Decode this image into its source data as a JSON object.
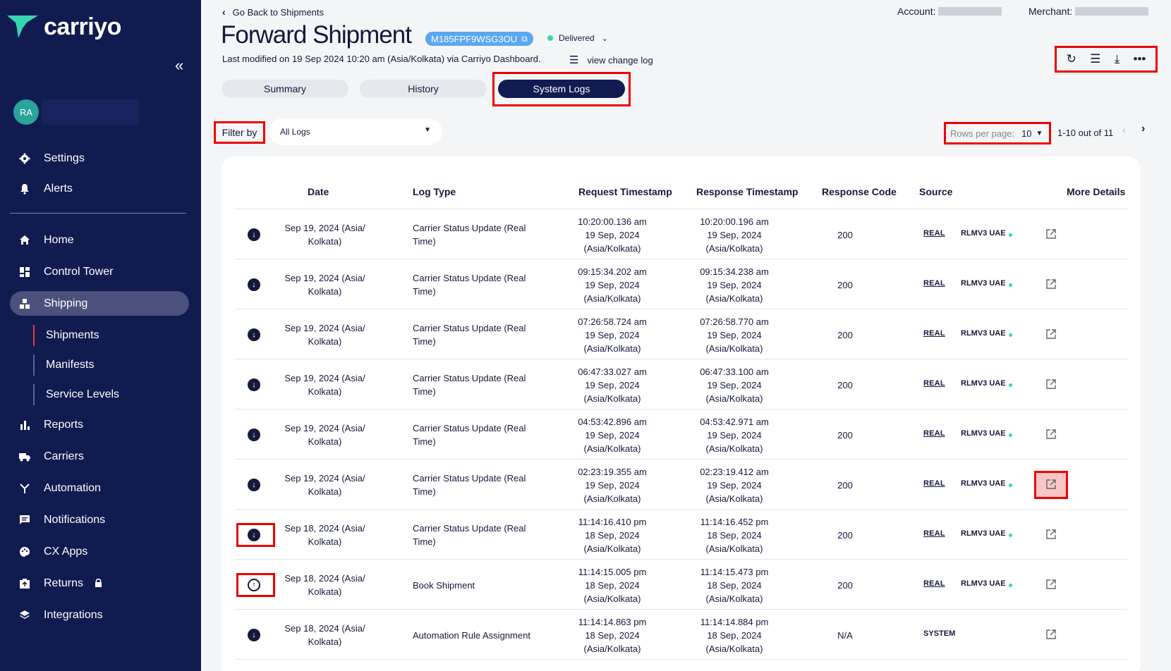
{
  "sidebar": {
    "brand": "carriyo",
    "avatar_initials": "RA",
    "settings": "Settings",
    "alerts": "Alerts",
    "home": "Home",
    "control_tower": "Control Tower",
    "shipping": "Shipping",
    "shipments": "Shipments",
    "manifests": "Manifests",
    "service_levels": "Service Levels",
    "reports": "Reports",
    "carriers": "Carriers",
    "automation": "Automation",
    "notifications": "Notifications",
    "cx_apps": "CX Apps",
    "returns": "Returns",
    "integrations": "Integrations"
  },
  "header": {
    "back": "Go Back to Shipments",
    "account_label": "Account:",
    "merchant_label": "Merchant:",
    "title": "Forward Shipment",
    "awb": "M185FPF9WSG3OU",
    "status": "Delivered",
    "modified": "Last modified on 19 Sep 2024 10:20 am (Asia/Kolkata) via Carriyo Dashboard.",
    "changelog": "view change log"
  },
  "tabs": {
    "summary": "Summary",
    "history": "History",
    "system_logs": "System Logs"
  },
  "filter": {
    "label": "Filter by",
    "value": "All Logs"
  },
  "pagination": {
    "rows_label": "Rows per page:",
    "rows_value": "10",
    "range": "1-10 out of 11"
  },
  "table": {
    "headers": {
      "date": "Date",
      "log_type": "Log Type",
      "request_ts": "Request Timestamp",
      "response_ts": "Response Timestamp",
      "response_code": "Response Code",
      "source": "Source",
      "more": "More Details"
    },
    "rows": [
      {
        "dir": "down",
        "date1": "Sep 19, 2024 (Asia/",
        "date2": "Kolkata)",
        "type1": "Carrier Status Update (Real",
        "type2": "Time)",
        "req1": "10:20:00.136 am",
        "req2": "19 Sep, 2024",
        "req3": "(Asia/Kolkata)",
        "res1": "10:20:00.196 am",
        "res2": "19 Sep, 2024",
        "res3": "(Asia/Kolkata)",
        "code": "200",
        "logo": "REAL",
        "src": "RLMV3 UAE"
      },
      {
        "dir": "down",
        "date1": "Sep 19, 2024 (Asia/",
        "date2": "Kolkata)",
        "type1": "Carrier Status Update (Real",
        "type2": "Time)",
        "req1": "09:15:34.202 am",
        "req2": "19 Sep, 2024",
        "req3": "(Asia/Kolkata)",
        "res1": "09:15:34.238 am",
        "res2": "19 Sep, 2024",
        "res3": "(Asia/Kolkata)",
        "code": "200",
        "logo": "REAL",
        "src": "RLMV3 UAE"
      },
      {
        "dir": "down",
        "date1": "Sep 19, 2024 (Asia/",
        "date2": "Kolkata)",
        "type1": "Carrier Status Update (Real",
        "type2": "Time)",
        "req1": "07:26:58.724 am",
        "req2": "19 Sep, 2024",
        "req3": "(Asia/Kolkata)",
        "res1": "07:26:58.770 am",
        "res2": "19 Sep, 2024",
        "res3": "(Asia/Kolkata)",
        "code": "200",
        "logo": "REAL",
        "src": "RLMV3 UAE"
      },
      {
        "dir": "down",
        "date1": "Sep 19, 2024 (Asia/",
        "date2": "Kolkata)",
        "type1": "Carrier Status Update (Real",
        "type2": "Time)",
        "req1": "06:47:33.027 am",
        "req2": "19 Sep, 2024",
        "req3": "(Asia/Kolkata)",
        "res1": "06:47:33.100 am",
        "res2": "19 Sep, 2024",
        "res3": "(Asia/Kolkata)",
        "code": "200",
        "logo": "REAL",
        "src": "RLMV3 UAE"
      },
      {
        "dir": "down",
        "date1": "Sep 19, 2024 (Asia/",
        "date2": "Kolkata)",
        "type1": "Carrier Status Update (Real",
        "type2": "Time)",
        "req1": "04:53:42.896 am",
        "req2": "19 Sep, 2024",
        "req3": "(Asia/Kolkata)",
        "res1": "04:53:42.971 am",
        "res2": "19 Sep, 2024",
        "res3": "(Asia/Kolkata)",
        "code": "200",
        "logo": "REAL",
        "src": "RLMV3 UAE"
      },
      {
        "dir": "down",
        "date1": "Sep 19, 2024 (Asia/",
        "date2": "Kolkata)",
        "type1": "Carrier Status Update (Real",
        "type2": "Time)",
        "req1": "02:23:19.355 am",
        "req2": "19 Sep, 2024",
        "req3": "(Asia/Kolkata)",
        "res1": "02:23:19.412 am",
        "res2": "19 Sep, 2024",
        "res3": "(Asia/Kolkata)",
        "code": "200",
        "logo": "REAL",
        "src": "RLMV3 UAE"
      },
      {
        "dir": "down",
        "date1": "Sep 18, 2024 (Asia/",
        "date2": "Kolkata)",
        "type1": "Carrier Status Update (Real",
        "type2": "Time)",
        "req1": "11:14:16.410 pm",
        "req2": "18 Sep, 2024",
        "req3": "(Asia/Kolkata)",
        "res1": "11:14:16.452 pm",
        "res2": "18 Sep, 2024",
        "res3": "(Asia/Kolkata)",
        "code": "200",
        "logo": "REAL",
        "src": "RLMV3 UAE"
      },
      {
        "dir": "up",
        "date1": "Sep 18, 2024 (Asia/",
        "date2": "Kolkata)",
        "type1": "Book Shipment",
        "type2": "",
        "req1": "11:14:15.005 pm",
        "req2": "18 Sep, 2024",
        "req3": "(Asia/Kolkata)",
        "res1": "11:14:15.473 pm",
        "res2": "18 Sep, 2024",
        "res3": "(Asia/Kolkata)",
        "code": "200",
        "logo": "REAL",
        "src": "RLMV3 UAE"
      },
      {
        "dir": "down",
        "date1": "Sep 18, 2024 (Asia/",
        "date2": "Kolkata)",
        "type1": "Automation Rule Assignment",
        "type2": "",
        "req1": "11:14:14.863 pm",
        "req2": "18 Sep, 2024",
        "req3": "(Asia/Kolkata)",
        "res1": "11:14:14.884 pm",
        "res2": "18 Sep, 2024",
        "res3": "(Asia/Kolkata)",
        "code": "N/A",
        "logo": "",
        "src": "SYSTEM"
      }
    ]
  }
}
